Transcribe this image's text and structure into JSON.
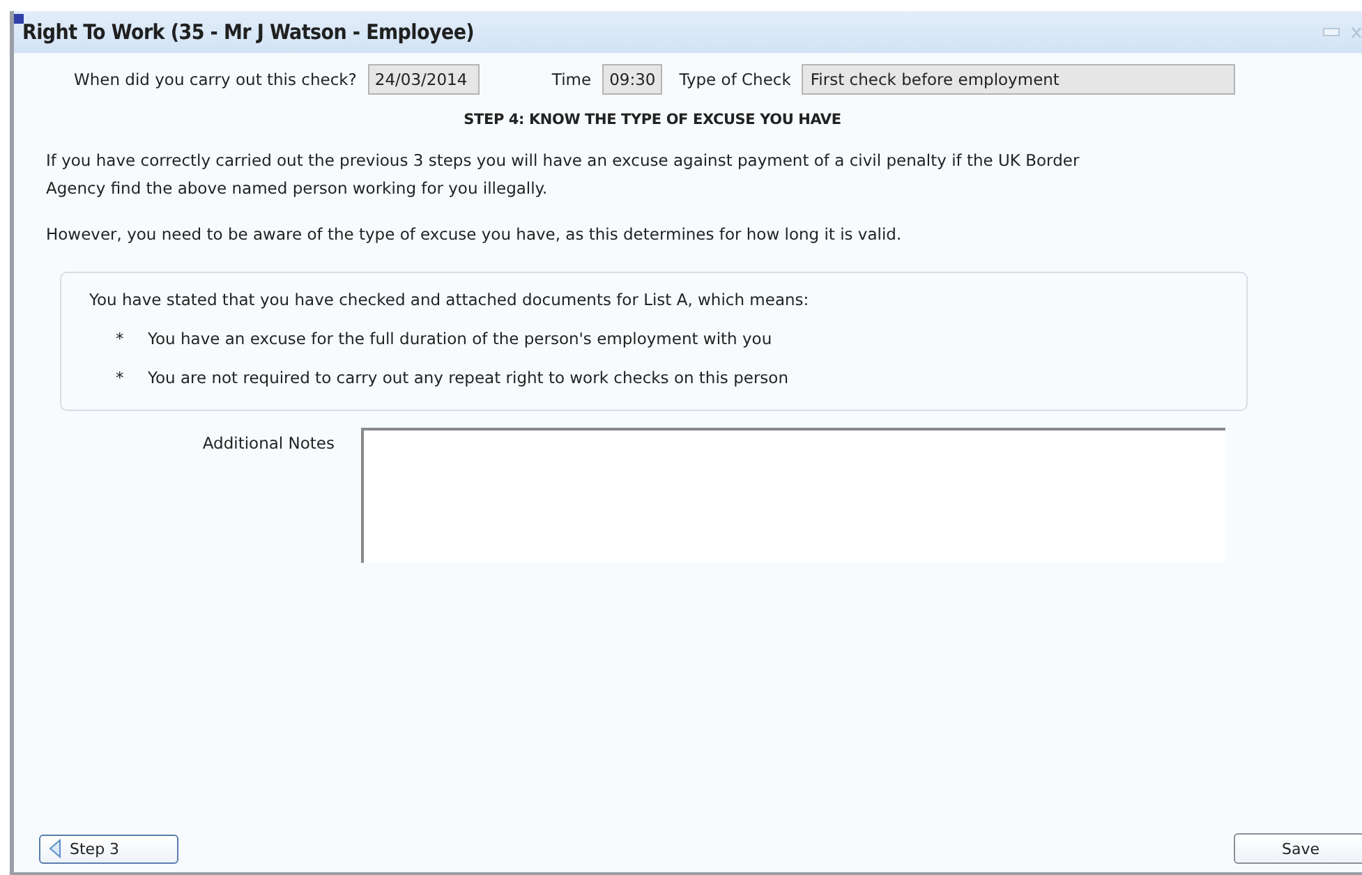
{
  "window": {
    "title": "Right To Work (35 - Mr J Watson - Employee)"
  },
  "check": {
    "date_label": "When did you carry out this check?",
    "date": "24/03/2014",
    "time_label": "Time",
    "time": "09:30",
    "type_label": "Type of Check",
    "type": "First check before employment"
  },
  "heading": "STEP 4: KNOW THE TYPE OF EXCUSE YOU HAVE",
  "paragraphs": [
    "If you have correctly carried out the previous 3 steps you will have an excuse against payment of a civil penalty if the UK Border Agency find the above named person working for you illegally.",
    "However, you need to be aware of the type of excuse you have, as this determines for how long it is valid."
  ],
  "summary": {
    "intro": "You have stated that you have checked and attached documents for List A, which means:",
    "bullets": [
      {
        "mark": "*",
        "text": "You have an excuse for the full duration of the person's employment with you"
      },
      {
        "mark": "*",
        "text": "You are not required to carry out any repeat right to work checks on this person"
      }
    ]
  },
  "notes": {
    "label": "Additional Notes"
  },
  "buttons": [
    {
      "kind": "back",
      "label": "Step 3"
    },
    {
      "kind": "save",
      "label": "Save"
    }
  ]
}
